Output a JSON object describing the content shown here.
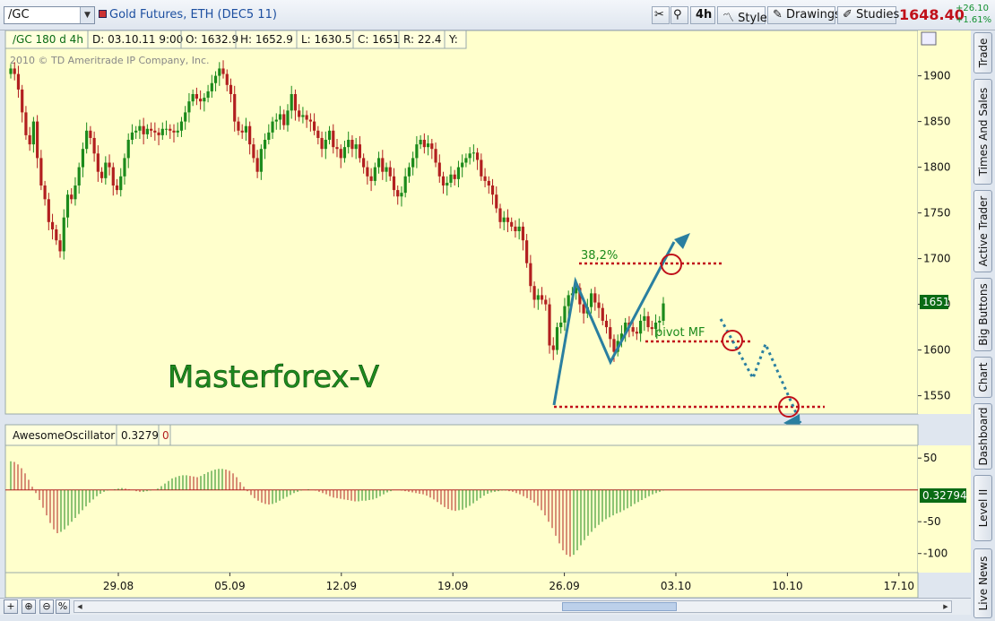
{
  "toolbar": {
    "symbol": "/GC",
    "description": "Gold Futures, ETH (DEC5 11)",
    "timeframe": "4h",
    "style_label": "Style",
    "drawings_label": "Drawings",
    "studies_label": "Studies",
    "last_price": "1648.40",
    "net_change": "+26.10",
    "pct_change": "+1.61%"
  },
  "header": {
    "symbol_period": "/GC 180 d 4h",
    "date": "D: 03.10.11 9:00",
    "open": "O: 1632.9",
    "high": "H: 1652.9",
    "low": "L: 1630.5",
    "close": "C: 1651",
    "range": "R: 22.4",
    "y": "Y:"
  },
  "copyright": "2010 © TD Ameritrade IP Company, Inc.",
  "watermark": "Masterforex-V",
  "annotations": {
    "fib": "38,2%",
    "pivot": "pivot MF"
  },
  "price_marker": "1651",
  "oscillator": {
    "name": "AwesomeOscillator",
    "value": "0.3279",
    "zero": "0",
    "marker": "0.32794"
  },
  "sidebar_tabs": [
    "Trade",
    "Times And Sales",
    "Active Trader",
    "Big Buttons",
    "Chart",
    "Dashboard",
    "Level II",
    "Live News"
  ],
  "bottom_buttons": [
    "+",
    "⊕",
    "⊖",
    "%"
  ],
  "colors": {
    "up": "#1b8a1b",
    "down": "#b21f1f",
    "background": "#ffffcc",
    "annotation": "#2a7fa0",
    "level": "#c0101a"
  },
  "chart_data": [
    {
      "type": "candlestick",
      "ylim": [
        1530,
        1930
      ],
      "ytick_labels": [
        "1900",
        "1850",
        "1800",
        "1750",
        "1700",
        "1650",
        "1600",
        "1550"
      ],
      "xtick_labels": [
        "29.08",
        "05.09",
        "12.09",
        "19.09",
        "26.09",
        "03.10",
        "10.10",
        "17.10"
      ],
      "close_series": [
        1908,
        1902,
        1885,
        1860,
        1835,
        1825,
        1850,
        1810,
        1780,
        1765,
        1740,
        1732,
        1720,
        1708,
        1745,
        1770,
        1765,
        1780,
        1800,
        1820,
        1840,
        1832,
        1815,
        1795,
        1788,
        1805,
        1800,
        1780,
        1775,
        1790,
        1810,
        1830,
        1838,
        1840,
        1845,
        1836,
        1842,
        1840,
        1838,
        1835,
        1842,
        1842,
        1840,
        1838,
        1840,
        1850,
        1860,
        1872,
        1880,
        1875,
        1872,
        1876,
        1883,
        1892,
        1900,
        1908,
        1902,
        1890,
        1880,
        1850,
        1840,
        1838,
        1845,
        1825,
        1810,
        1795,
        1820,
        1830,
        1838,
        1850,
        1852,
        1858,
        1846,
        1862,
        1880,
        1862,
        1855,
        1857,
        1852,
        1850,
        1840,
        1832,
        1820,
        1830,
        1840,
        1822,
        1820,
        1810,
        1822,
        1830,
        1820,
        1825,
        1810,
        1800,
        1790,
        1785,
        1800,
        1810,
        1795,
        1800,
        1790,
        1775,
        1768,
        1772,
        1790,
        1800,
        1810,
        1825,
        1830,
        1822,
        1826,
        1820,
        1805,
        1790,
        1780,
        1783,
        1792,
        1787,
        1800,
        1805,
        1810,
        1815,
        1816,
        1808,
        1790,
        1785,
        1780,
        1770,
        1755,
        1740,
        1745,
        1740,
        1735,
        1730,
        1735,
        1720,
        1695,
        1670,
        1655,
        1660,
        1655,
        1650,
        1605,
        1600,
        1625,
        1630,
        1648,
        1660,
        1662,
        1668,
        1650,
        1640,
        1647,
        1662,
        1652,
        1646,
        1632,
        1625,
        1612,
        1598,
        1610,
        1618,
        1630,
        1625,
        1620,
        1618,
        1632,
        1637,
        1625,
        1623,
        1630,
        1632,
        1651
      ],
      "annotation_levels": {
        "fib_38_2": 1695,
        "pivot_mf": 1607,
        "support": 1535
      }
    },
    {
      "type": "bar",
      "name": "AwesomeOscillator",
      "value": 0.3279,
      "ylim": [
        -130,
        70
      ],
      "ytick_labels": [
        "50",
        "-50",
        "-100"
      ],
      "values": [
        45,
        44,
        40,
        34,
        26,
        16,
        5,
        -5,
        -16,
        -28,
        -40,
        -52,
        -62,
        -68,
        -66,
        -62,
        -56,
        -50,
        -44,
        -38,
        -32,
        -26,
        -20,
        -15,
        -10,
        -6,
        -3,
        -1,
        0,
        1,
        2,
        3,
        2,
        1,
        0,
        -2,
        -3,
        -3,
        -2,
        -1,
        0,
        2,
        6,
        10,
        14,
        18,
        20,
        22,
        23,
        23,
        22,
        21,
        20,
        22,
        25,
        28,
        30,
        32,
        33,
        33,
        32,
        30,
        26,
        20,
        12,
        5,
        -2,
        -8,
        -13,
        -17,
        -20,
        -22,
        -23,
        -22,
        -20,
        -17,
        -14,
        -11,
        -8,
        -5,
        -3,
        -1,
        0,
        1,
        0,
        -1,
        -3,
        -5,
        -7,
        -10,
        -12,
        -13,
        -14,
        -15,
        -16,
        -17,
        -18,
        -18,
        -17,
        -17,
        -16,
        -15,
        -13,
        -10,
        -7,
        -4,
        -2,
        0,
        0,
        -1,
        -2,
        -3,
        -4,
        -5,
        -6,
        -7,
        -9,
        -12,
        -15,
        -19,
        -23,
        -27,
        -30,
        -32,
        -33,
        -32,
        -31,
        -28,
        -25,
        -21,
        -17,
        -13,
        -9,
        -6,
        -4,
        -3,
        -2,
        -1,
        -1,
        -2,
        -3,
        -5,
        -7,
        -10,
        -13,
        -16,
        -20,
        -25,
        -32,
        -40,
        -50,
        -60,
        -72,
        -84,
        -95,
        -102,
        -105,
        -102,
        -95,
        -87,
        -79,
        -72,
        -66,
        -60,
        -55,
        -50,
        -46,
        -43,
        -40,
        -37,
        -35,
        -32,
        -29,
        -26,
        -22,
        -19,
        -16,
        -13,
        -10,
        -7,
        -5,
        -3,
        -1
      ]
    }
  ]
}
